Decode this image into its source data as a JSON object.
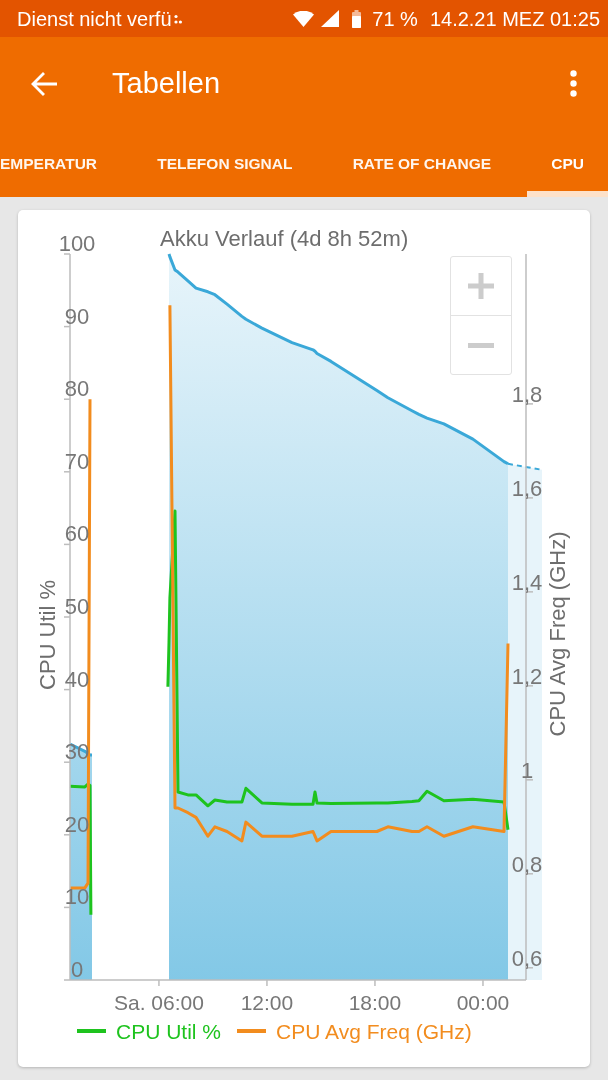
{
  "status_bar": {
    "carrier": "Dienst nicht verfü",
    "battery": "71 %",
    "clock": "14.2.21 MEZ 01:25"
  },
  "app_bar": {
    "title": "Tabellen"
  },
  "tabs": [
    {
      "label": "EMPERATUR",
      "selected": false
    },
    {
      "label": "TELEFON SIGNAL",
      "selected": false
    },
    {
      "label": "RATE OF CHANGE",
      "selected": false
    },
    {
      "label": "CPU",
      "selected": true
    }
  ],
  "chart": {
    "chart_data": {
      "type": "line",
      "title": "Akku Verlauf (4d 8h 52m)",
      "ylabel": "CPU Util %",
      "y2label": "CPU Avg Freq (GHz)",
      "legend": "bottom",
      "x": [
        1.06,
        1.89,
        2.06,
        2.17,
        2.22,
        2.28,
        6.5,
        6.56,
        6.61,
        6.89,
        7.06,
        7.61,
        8.06,
        8.72,
        9.11,
        9.78,
        10.61,
        10.83,
        11.72,
        13.39,
        14.56,
        14.67,
        14.78,
        15.56,
        18.11,
        18.72,
        20.06,
        20.44,
        20.89,
        21.83,
        23.44,
        25.17,
        25.39
      ],
      "xlim": [
        1.06,
        26.39
      ],
      "ylim": [
        0,
        100
      ],
      "y2lim": [
        0.574,
        2.119
      ],
      "xticks": [
        {
          "value": 6,
          "label": "Sa. 06:00"
        },
        {
          "value": 12,
          "label": "12:00"
        },
        {
          "value": 18,
          "label": "18:00"
        },
        {
          "value": 24,
          "label": "00:00"
        }
      ],
      "yticks": [
        0,
        10,
        20,
        30,
        40,
        50,
        60,
        70,
        80,
        90,
        100
      ],
      "y2ticks": [
        {
          "value": 0.6,
          "label": "0,6"
        },
        {
          "value": 0.8,
          "label": "0,8"
        },
        {
          "value": 1,
          "label": "1"
        },
        {
          "value": 1.2,
          "label": "1,2"
        },
        {
          "value": 1.4,
          "label": "1,4"
        },
        {
          "value": 1.6,
          "label": "1,6"
        },
        {
          "value": 1.8,
          "label": "1,8"
        }
      ],
      "series": [
        {
          "name": "CPU Util %",
          "color": "#1ec31e",
          "type": "line",
          "values": [
            26.7,
            26.6,
            27.0,
            26.8,
            9.0,
            null,
            40.4,
            46.5,
            52.6,
            64.6,
            25.9,
            25.5,
            25.5,
            24.0,
            24.8,
            24.5,
            24.5,
            26.4,
            24.4,
            24.2,
            24.2,
            25.9,
            24.4,
            24.3,
            24.4,
            24.4,
            24.6,
            24.7,
            26.0,
            24.7,
            24.9,
            24.5,
            20.7
          ]
        },
        {
          "name": "CPU Avg Freq (GHz)",
          "color": "#f28c1e",
          "type": "line",
          "axis": "y2",
          "values": [
            0.77,
            0.77,
            0.78,
            1.81,
            null,
            null,
            null,
            null,
            2.01,
            0.94,
            0.94,
            0.93,
            0.92,
            0.88,
            0.9,
            0.89,
            0.87,
            0.91,
            0.88,
            0.88,
            0.89,
            0.88,
            0.87,
            0.89,
            0.89,
            0.9,
            0.89,
            0.89,
            0.9,
            0.88,
            0.9,
            0.89,
            1.29
          ]
        },
        {
          "color": "#3aa8d8",
          "type": "area",
          "values": [
            32.5,
            31.5,
            31.2,
            31.0,
            31.0,
            31.0,
            null,
            100,
            99.6,
            97.8,
            97.5,
            96.3,
            95.3,
            94.8,
            94.4,
            93.1,
            91.4,
            91.0,
            89.8,
            87.8,
            86.8,
            86.6,
            86.3,
            85.2,
            81.2,
            80.2,
            78.4,
            77.9,
            77.4,
            76.6,
            74.5,
            71.4,
            71.1
          ]
        }
      ]
    }
  }
}
